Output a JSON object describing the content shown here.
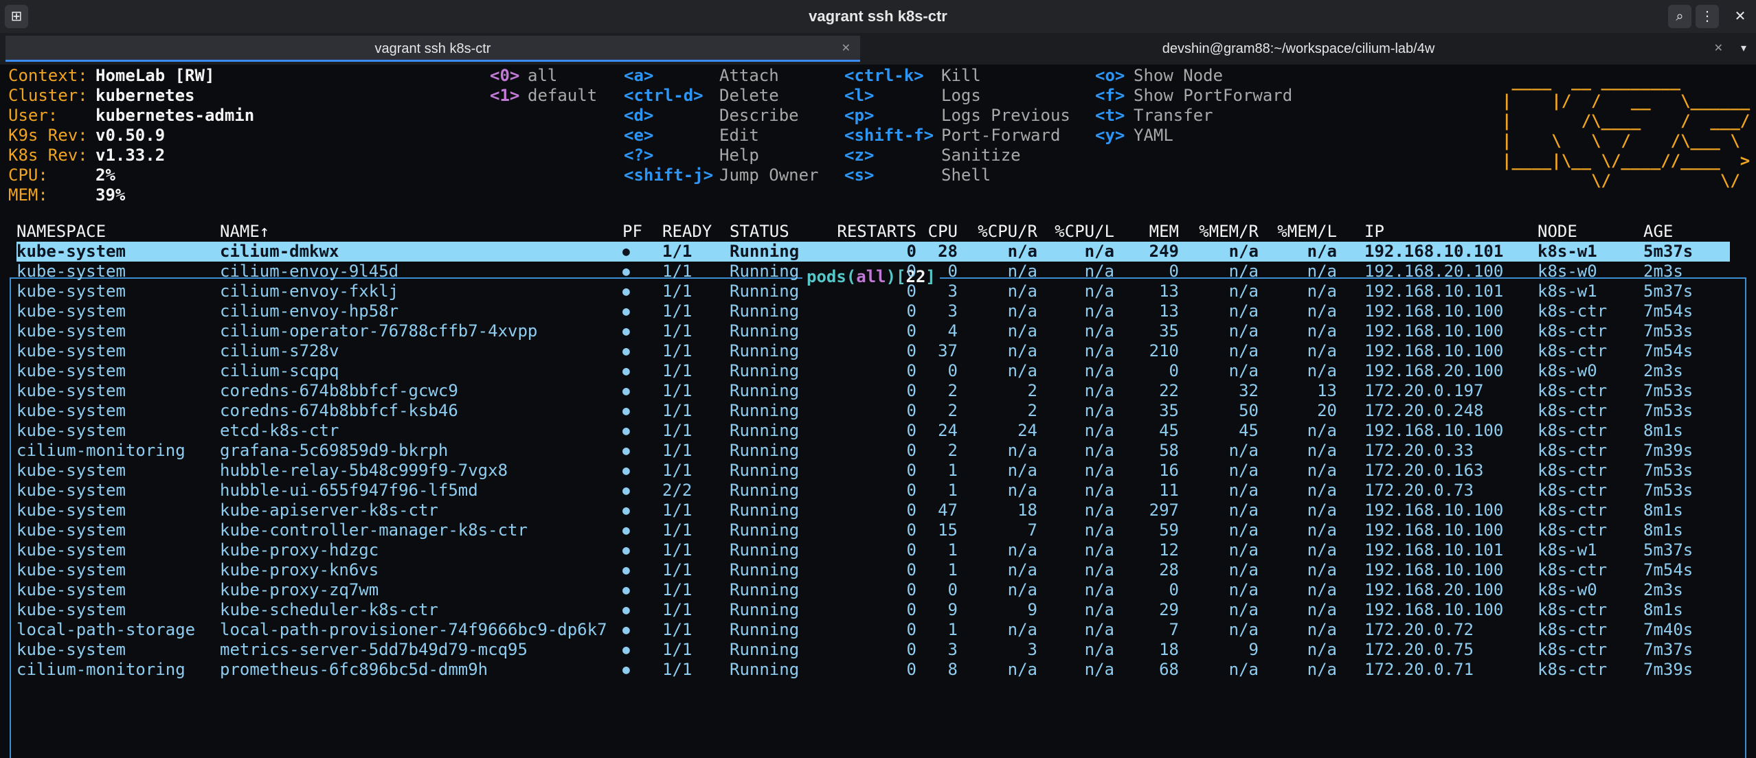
{
  "window": {
    "title": "vagrant ssh k8s-ctr"
  },
  "tabs": [
    {
      "label": "vagrant ssh k8s-ctr",
      "active": true
    },
    {
      "label": "devshin@gram88:~/workspace/cilium-lab/4w",
      "active": false
    }
  ],
  "info": [
    {
      "label": "Context:",
      "value": "HomeLab [RW]"
    },
    {
      "label": "Cluster:",
      "value": "kubernetes"
    },
    {
      "label": "User:",
      "value": "kubernetes-admin"
    },
    {
      "label": "K9s Rev:",
      "value": "v0.50.9"
    },
    {
      "label": "K8s Rev:",
      "value": "v1.33.2"
    },
    {
      "label": "CPU:",
      "value": "2%"
    },
    {
      "label": "MEM:",
      "value": "39%"
    }
  ],
  "namespace_shortcuts": [
    {
      "key": "<0>",
      "label": "all"
    },
    {
      "key": "<1>",
      "label": "default"
    }
  ],
  "hotkeys": [
    [
      {
        "key": "<a>",
        "label": "Attach"
      },
      {
        "key": "<ctrl-d>",
        "label": "Delete"
      },
      {
        "key": "<d>",
        "label": "Describe"
      },
      {
        "key": "<e>",
        "label": "Edit"
      },
      {
        "key": "<?>",
        "label": "Help"
      },
      {
        "key": "<shift-j>",
        "label": "Jump Owner"
      }
    ],
    [
      {
        "key": "<ctrl-k>",
        "label": "Kill"
      },
      {
        "key": "<l>",
        "label": "Logs"
      },
      {
        "key": "<p>",
        "label": "Logs Previous"
      },
      {
        "key": "<shift-f>",
        "label": "Port-Forward"
      },
      {
        "key": "<z>",
        "label": "Sanitize"
      },
      {
        "key": "<s>",
        "label": "Shell"
      }
    ],
    [
      {
        "key": "<o>",
        "label": "Show Node"
      },
      {
        "key": "<f>",
        "label": "Show PortForward"
      },
      {
        "key": "<t>",
        "label": "Transfer"
      },
      {
        "key": "<y>",
        "label": "YAML"
      }
    ]
  ],
  "logo_lines": [
    " ____  __ ________       ",
    "|    |/  /   __   \\______",
    "|       /\\____    /  ___/",
    "|    \\   \\  /    /\\___ \\ ",
    "|____|\\__ \\/____//____  >",
    "         \\/           \\/ "
  ],
  "table": {
    "title_resource": "pods",
    "title_ns": "all",
    "title_count": "22",
    "columns": [
      "NAMESPACE",
      "NAME↑",
      "PF",
      "READY",
      "STATUS",
      "RESTARTS",
      "CPU",
      "%CPU/R",
      "%CPU/L",
      "MEM",
      "%MEM/R",
      "%MEM/L",
      "IP",
      "NODE",
      "AGE"
    ],
    "pf_symbol": "●",
    "rows": [
      [
        "kube-system",
        "cilium-dmkwx",
        "1/1",
        "Running",
        "0",
        "28",
        "n/a",
        "n/a",
        "249",
        "n/a",
        "n/a",
        "192.168.10.101",
        "k8s-w1",
        "5m37s"
      ],
      [
        "kube-system",
        "cilium-envoy-9l45d",
        "1/1",
        "Running",
        "0",
        "0",
        "n/a",
        "n/a",
        "0",
        "n/a",
        "n/a",
        "192.168.20.100",
        "k8s-w0",
        "2m3s"
      ],
      [
        "kube-system",
        "cilium-envoy-fxklj",
        "1/1",
        "Running",
        "0",
        "3",
        "n/a",
        "n/a",
        "13",
        "n/a",
        "n/a",
        "192.168.10.101",
        "k8s-w1",
        "5m37s"
      ],
      [
        "kube-system",
        "cilium-envoy-hp58r",
        "1/1",
        "Running",
        "0",
        "3",
        "n/a",
        "n/a",
        "13",
        "n/a",
        "n/a",
        "192.168.10.100",
        "k8s-ctr",
        "7m54s"
      ],
      [
        "kube-system",
        "cilium-operator-76788cffb7-4xvpp",
        "1/1",
        "Running",
        "0",
        "4",
        "n/a",
        "n/a",
        "35",
        "n/a",
        "n/a",
        "192.168.10.100",
        "k8s-ctr",
        "7m53s"
      ],
      [
        "kube-system",
        "cilium-s728v",
        "1/1",
        "Running",
        "0",
        "37",
        "n/a",
        "n/a",
        "210",
        "n/a",
        "n/a",
        "192.168.10.100",
        "k8s-ctr",
        "7m54s"
      ],
      [
        "kube-system",
        "cilium-scqpq",
        "1/1",
        "Running",
        "0",
        "0",
        "n/a",
        "n/a",
        "0",
        "n/a",
        "n/a",
        "192.168.20.100",
        "k8s-w0",
        "2m3s"
      ],
      [
        "kube-system",
        "coredns-674b8bbfcf-gcwc9",
        "1/1",
        "Running",
        "0",
        "2",
        "2",
        "n/a",
        "22",
        "32",
        "13",
        "172.20.0.197",
        "k8s-ctr",
        "7m53s"
      ],
      [
        "kube-system",
        "coredns-674b8bbfcf-ksb46",
        "1/1",
        "Running",
        "0",
        "2",
        "2",
        "n/a",
        "35",
        "50",
        "20",
        "172.20.0.248",
        "k8s-ctr",
        "7m53s"
      ],
      [
        "kube-system",
        "etcd-k8s-ctr",
        "1/1",
        "Running",
        "0",
        "24",
        "24",
        "n/a",
        "45",
        "45",
        "n/a",
        "192.168.10.100",
        "k8s-ctr",
        "8m1s"
      ],
      [
        "cilium-monitoring",
        "grafana-5c69859d9-bkrph",
        "1/1",
        "Running",
        "0",
        "2",
        "n/a",
        "n/a",
        "58",
        "n/a",
        "n/a",
        "172.20.0.33",
        "k8s-ctr",
        "7m39s"
      ],
      [
        "kube-system",
        "hubble-relay-5b48c999f9-7vgx8",
        "1/1",
        "Running",
        "0",
        "1",
        "n/a",
        "n/a",
        "16",
        "n/a",
        "n/a",
        "172.20.0.163",
        "k8s-ctr",
        "7m53s"
      ],
      [
        "kube-system",
        "hubble-ui-655f947f96-lf5md",
        "2/2",
        "Running",
        "0",
        "1",
        "n/a",
        "n/a",
        "11",
        "n/a",
        "n/a",
        "172.20.0.73",
        "k8s-ctr",
        "7m53s"
      ],
      [
        "kube-system",
        "kube-apiserver-k8s-ctr",
        "1/1",
        "Running",
        "0",
        "47",
        "18",
        "n/a",
        "297",
        "n/a",
        "n/a",
        "192.168.10.100",
        "k8s-ctr",
        "8m1s"
      ],
      [
        "kube-system",
        "kube-controller-manager-k8s-ctr",
        "1/1",
        "Running",
        "0",
        "15",
        "7",
        "n/a",
        "59",
        "n/a",
        "n/a",
        "192.168.10.100",
        "k8s-ctr",
        "8m1s"
      ],
      [
        "kube-system",
        "kube-proxy-hdzgc",
        "1/1",
        "Running",
        "0",
        "1",
        "n/a",
        "n/a",
        "12",
        "n/a",
        "n/a",
        "192.168.10.101",
        "k8s-w1",
        "5m37s"
      ],
      [
        "kube-system",
        "kube-proxy-kn6vs",
        "1/1",
        "Running",
        "0",
        "1",
        "n/a",
        "n/a",
        "28",
        "n/a",
        "n/a",
        "192.168.10.100",
        "k8s-ctr",
        "7m54s"
      ],
      [
        "kube-system",
        "kube-proxy-zq7wm",
        "1/1",
        "Running",
        "0",
        "0",
        "n/a",
        "n/a",
        "0",
        "n/a",
        "n/a",
        "192.168.20.100",
        "k8s-w0",
        "2m3s"
      ],
      [
        "kube-system",
        "kube-scheduler-k8s-ctr",
        "1/1",
        "Running",
        "0",
        "9",
        "9",
        "n/a",
        "29",
        "n/a",
        "n/a",
        "192.168.10.100",
        "k8s-ctr",
        "8m1s"
      ],
      [
        "local-path-storage",
        "local-path-provisioner-74f9666bc9-dp6k7",
        "1/1",
        "Running",
        "0",
        "1",
        "n/a",
        "n/a",
        "7",
        "n/a",
        "n/a",
        "172.20.0.72",
        "k8s-ctr",
        "7m40s"
      ],
      [
        "kube-system",
        "metrics-server-5dd7b49d79-mcq95",
        "1/1",
        "Running",
        "0",
        "3",
        "3",
        "n/a",
        "18",
        "9",
        "n/a",
        "172.20.0.75",
        "k8s-ctr",
        "7m37s"
      ],
      [
        "cilium-monitoring",
        "prometheus-6fc896bc5d-dmm9h",
        "1/1",
        "Running",
        "0",
        "8",
        "n/a",
        "n/a",
        "68",
        "n/a",
        "n/a",
        "172.20.0.71",
        "k8s-ctr",
        "7m39s"
      ]
    ]
  },
  "colors": {
    "accent": "#3a8cf2",
    "info_label": "#f0a422",
    "hotkey": "#2d95f4",
    "ns_key": "#c07ad6",
    "row_text": "#8ecdf0",
    "selected_row_bg": "#8fd8f8",
    "border": "#3c8fd2"
  }
}
